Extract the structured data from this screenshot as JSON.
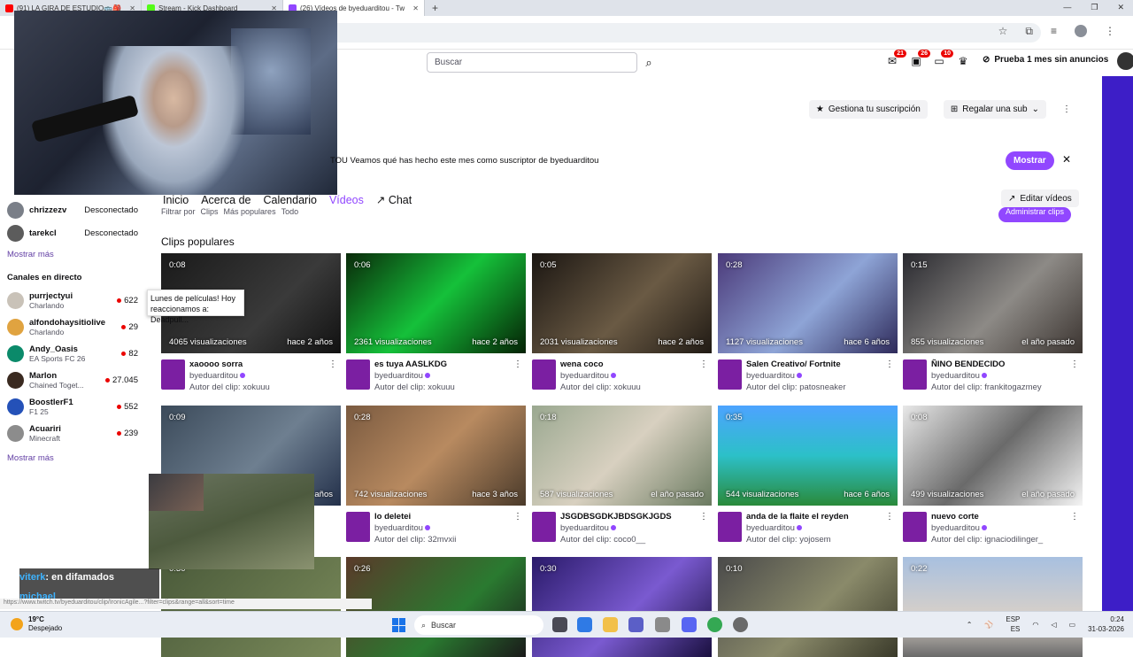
{
  "browser": {
    "tabs": [
      {
        "label": "(91) LA GIRA DE ESTUDIO🚌🎒",
        "color": "#ff0000"
      },
      {
        "label": "Stream - Kick Dashboard",
        "color": "#53fc18"
      },
      {
        "label": "(26) Vídeos de byeduarditou - Tw",
        "color": "#9147ff"
      }
    ],
    "new_tab": "+"
  },
  "topnav": {
    "search_placeholder": "Buscar",
    "badges": {
      "inbox": "21",
      "whispers": "26",
      "notifications": "10"
    },
    "prime_label": "Prueba 1 mes sin anuncios"
  },
  "header_actions": {
    "manage_sub": "Gestiona tu suscripción",
    "gift_sub": "Regalar una sub"
  },
  "banner": {
    "text": "TOU Veamos qué has hecho este mes como suscriptor de byeduarditou",
    "button": "Mostrar"
  },
  "channel_tabs": [
    "Inicio",
    "Acerca de",
    "Calendario",
    "Vídeos",
    "Chat"
  ],
  "edit_videos": "Editar vídeos",
  "filter": {
    "label": "Filtrar por",
    "value": "Clips",
    "sort": "Más populares",
    "range": "Todo"
  },
  "manage_clips": "Administrar clips",
  "sidebar": {
    "offline": [
      {
        "name": "chrizzezv",
        "status": "Desconectado",
        "color": "#7a7f88"
      },
      {
        "name": "tarekcl",
        "status": "Desconectado",
        "color": "#5c5c5c"
      }
    ],
    "show_more_1": "Mostrar más",
    "live_heading": "Canales en directo",
    "live": [
      {
        "name": "purrjectyui",
        "game": "Charlando",
        "viewers": "622",
        "color": "#c9c2b8"
      },
      {
        "name": "alfondohaysitiolive",
        "game": "Charlando",
        "viewers": "29",
        "color": "#e0a340"
      },
      {
        "name": "Andy_Oasis",
        "game": "EA Sports FC 26",
        "viewers": "82",
        "color": "#0b8a6a"
      },
      {
        "name": "Marlon",
        "game": "Chained Toget...",
        "viewers": "27.045",
        "color": "#3a2a20"
      },
      {
        "name": "BoostlerF1",
        "game": "F1 25",
        "viewers": "552",
        "color": "#2451b8"
      },
      {
        "name": "Acuariri",
        "game": "Minecraft",
        "viewers": "239",
        "color": "#8c8c8c"
      }
    ],
    "show_more_2": "Mostrar más"
  },
  "section_title": "Clips populares",
  "tooltip": "Lunes de películas! Hoy reaccionamos a: Deadpull...",
  "clips": [
    {
      "duration": "0:08",
      "views": "4065 visualizaciones",
      "age": "hace 2 años",
      "title": "xaoooo sorra",
      "channel": "byeduarditou",
      "author": "Autor del clip: xokuuu",
      "bg": "linear-gradient(135deg,#1a1a1a,#3a3a3a 60%,#111)"
    },
    {
      "duration": "0:06",
      "views": "2361 visualizaciones",
      "age": "hace 2 años",
      "title": "es tuya AASLKDG",
      "channel": "byeduarditou",
      "author": "Autor del clip: xokuuu",
      "bg": "linear-gradient(135deg,#0a2a0a,#15c13a 50%,#052205)"
    },
    {
      "duration": "0:05",
      "views": "2031 visualizaciones",
      "age": "hace 2 años",
      "title": "wena coco",
      "channel": "byeduarditou",
      "author": "Autor del clip: xokuuu",
      "bg": "linear-gradient(135deg,#1b1612,#6a5a44 55%,#201a14)"
    },
    {
      "duration": "0:28",
      "views": "1127 visualizaciones",
      "age": "hace 6 años",
      "title": "Salen Creativo/ Fortnite",
      "channel": "byeduarditou",
      "author": "Autor del clip: patosneaker",
      "bg": "linear-gradient(135deg,#4b3a7a,#8ea4d6 55%,#2e2a5a)"
    },
    {
      "duration": "0:15",
      "views": "855 visualizaciones",
      "age": "el año pasado",
      "title": "ÑINO BENDECIDO",
      "channel": "byeduarditou",
      "author": "Autor del clip: frankitogazmey",
      "bg": "linear-gradient(135deg,#2a2a30,#8d8a86 55%,#3b3430)"
    },
    {
      "duration": "0:09",
      "views": "",
      "age": "años",
      "title": "",
      "channel": "",
      "author": "",
      "bg": "linear-gradient(135deg,#3b4a5a,#6e7f90 55%,#23304a)"
    },
    {
      "duration": "0:28",
      "views": "742 visualizaciones",
      "age": "hace 3 años",
      "title": "lo deletei",
      "channel": "byeduarditou",
      "author": "Autor del clip: 32mvxii",
      "bg": "linear-gradient(135deg,#7a5a40,#b88a60 50%,#4a3a2a)"
    },
    {
      "duration": "0:18",
      "views": "587 visualizaciones",
      "age": "el año pasado",
      "title": "JSGDBSGDKJBDSGKJGDS",
      "channel": "byeduarditou",
      "author": "Autor del clip: coco0__",
      "bg": "linear-gradient(135deg,#9aa890,#d8d0c0 50%,#6a7a60)"
    },
    {
      "duration": "0:35",
      "views": "544 visualizaciones",
      "age": "hace 6 años",
      "title": "anda de la flaite el reyden",
      "channel": "byeduarditou",
      "author": "Autor del clip: yojosem",
      "bg": "linear-gradient(180deg,#4da3ff,#2cc0c8 50%,#2a8a3a)"
    },
    {
      "duration": "0:08",
      "views": "499 visualizaciones",
      "age": "el año pasado",
      "title": "nuevo corte",
      "channel": "byeduarditou",
      "author": "Autor del clip: ignaciodilinger_",
      "bg": "linear-gradient(135deg,#e8e8e8,#6a6a6a 50%,#f4f4f4)"
    },
    {
      "duration": "0:30",
      "views": "",
      "age": "",
      "title": "",
      "channel": "",
      "author": "",
      "bg": "linear-gradient(135deg,#4a5a3a,#7a8a5a)"
    },
    {
      "duration": "0:26",
      "views": "",
      "age": "",
      "title": "",
      "channel": "",
      "author": "",
      "bg": "linear-gradient(135deg,#5a3a2a,#2a7a30 60%,#1a1a1a)"
    },
    {
      "duration": "0:30",
      "views": "",
      "age": "",
      "title": "",
      "channel": "",
      "author": "",
      "bg": "linear-gradient(135deg,#2a1a6a,#7a5ad0 55%,#1a1040)"
    },
    {
      "duration": "0:10",
      "views": "",
      "age": "",
      "title": "",
      "channel": "",
      "author": "",
      "bg": "linear-gradient(135deg,#4a4a4a,#8a8a6a 55%,#3a3a2a)"
    },
    {
      "duration": "0:22",
      "views": "",
      "age": "",
      "title": "",
      "channel": "",
      "author": "",
      "bg": "linear-gradient(180deg,#a8c0e0,#d8d0c8 60%,#6a6a6a)"
    }
  ],
  "overlay_chat": [
    {
      "user": "viterk",
      "msg": ": en difamados"
    },
    {
      "user": "michael",
      "msg": ""
    }
  ],
  "status_url": "https://www.twitch.tv/byeduarditou/clip/IronicAgile...?filter=clips&range=all&sort=time",
  "taskbar": {
    "temp": "19°C",
    "weather": "Despejado",
    "search": "Buscar",
    "lang1": "ESP",
    "lang2": "ES",
    "time": "0:24",
    "date": "31-03-2026"
  }
}
